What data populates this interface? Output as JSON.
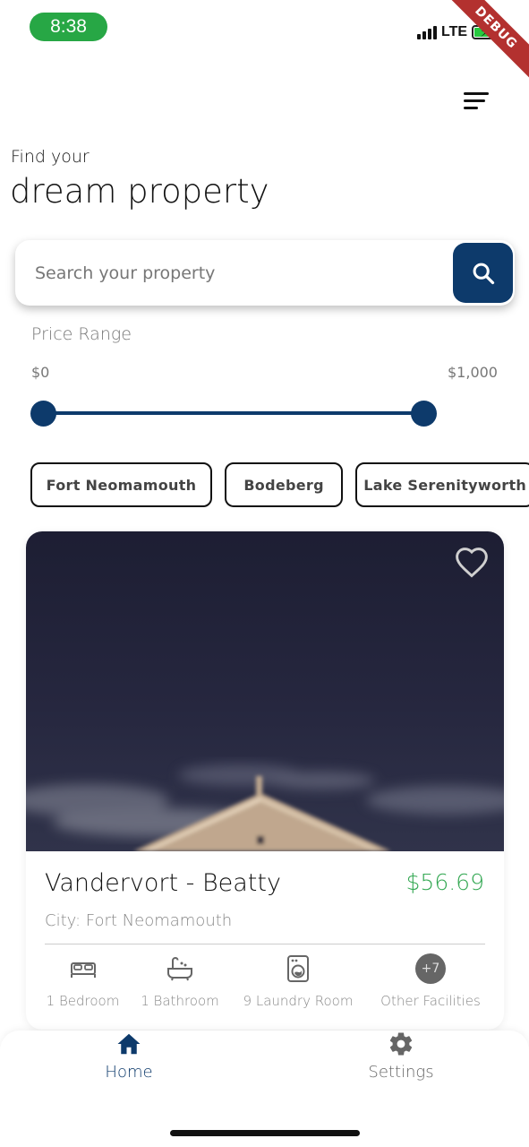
{
  "status_bar": {
    "time": "8:38",
    "network": "LTE",
    "debug_label": "DEBUG"
  },
  "header": {
    "menu_icon": "menu-icon"
  },
  "hero": {
    "subtitle": "Find your",
    "title": "dream property"
  },
  "search": {
    "placeholder": "Search your property",
    "value": "",
    "icon": "search-icon"
  },
  "price_range": {
    "label": "Price Range",
    "min_label": "$0",
    "max_label": "$1,000",
    "min_value": 0,
    "max_value": 1000
  },
  "locations": [
    "Fort Neomamouth",
    "Bodeberg",
    "Lake Serenityworth"
  ],
  "property_card": {
    "title": "Vandervort - Beatty",
    "price": "$56.69",
    "city": "City: Fort Neomamouth",
    "favorite_icon": "heart-outline-icon",
    "facilities": [
      {
        "icon": "bed-icon",
        "label": "1 Bedroom"
      },
      {
        "icon": "bathtub-icon",
        "label": "1 Bathroom"
      },
      {
        "icon": "washing-machine-icon",
        "label": "9 Laundry Room"
      },
      {
        "icon": "plus-badge",
        "badge": "+7",
        "label": "Other Facilities"
      }
    ]
  },
  "bottom_nav": {
    "items": [
      {
        "label": "Home",
        "icon": "home-icon",
        "active": true
      },
      {
        "label": "Settings",
        "icon": "gear-icon",
        "active": false
      }
    ]
  },
  "colors": {
    "primary": "#0d3a6b",
    "price_green": "#34a853",
    "status_green": "#27a745",
    "debug_red": "#b3312f"
  }
}
